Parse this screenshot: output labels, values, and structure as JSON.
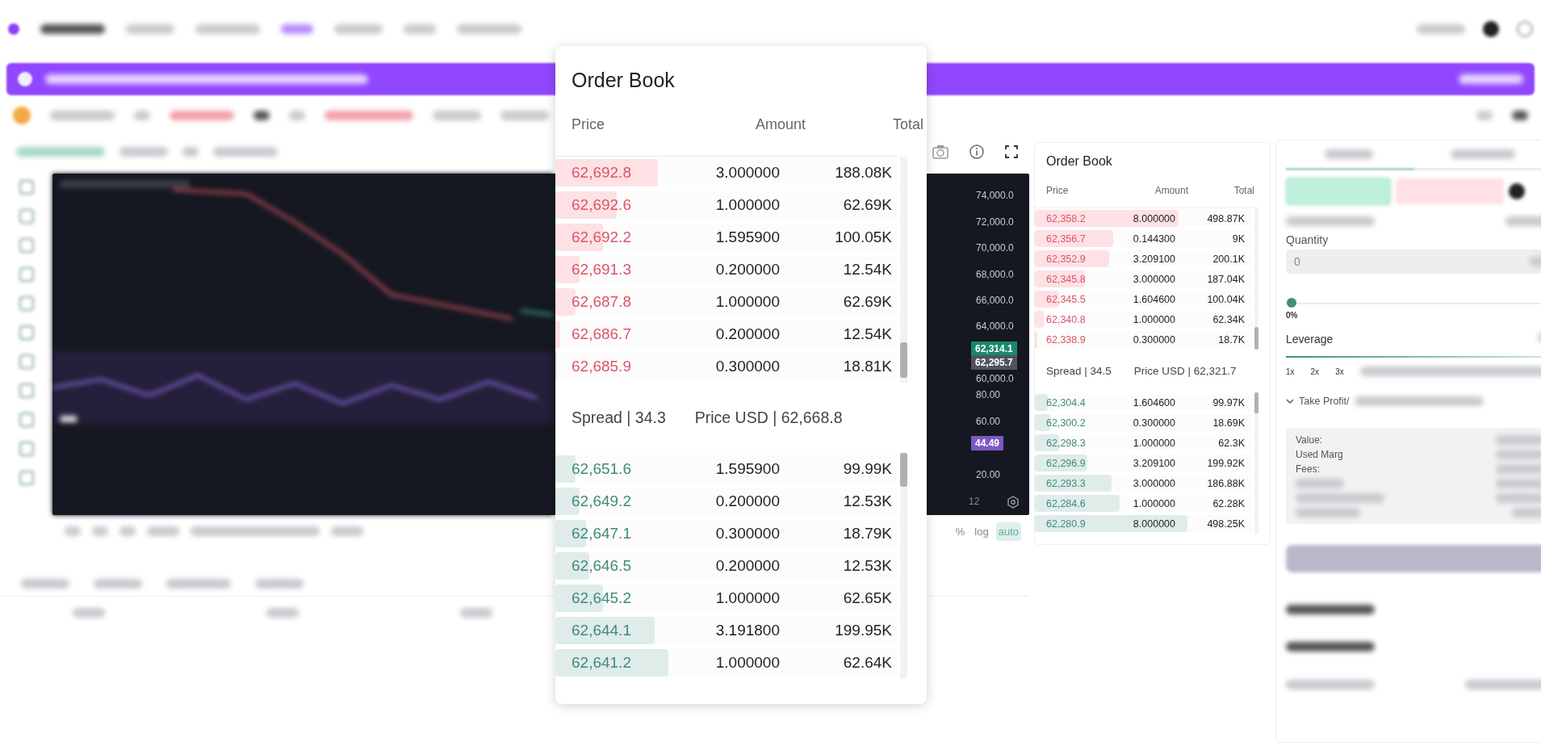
{
  "overlay_order_book": {
    "title": "Order Book",
    "columns": [
      "Price",
      "Amount",
      "Total"
    ],
    "asks": [
      {
        "price": "62,692.8",
        "amount": "3.000000",
        "total": "188.08K",
        "level": 0.3
      },
      {
        "price": "62,692.6",
        "amount": "1.000000",
        "total": "62.69K",
        "level": 0.18
      },
      {
        "price": "62,692.2",
        "amount": "1.595900",
        "total": "100.05K",
        "level": 0.14
      },
      {
        "price": "62,691.3",
        "amount": "0.200000",
        "total": "12.54K",
        "level": 0.07
      },
      {
        "price": "62,687.8",
        "amount": "1.000000",
        "total": "62.69K",
        "level": 0.06
      },
      {
        "price": "62,686.7",
        "amount": "0.200000",
        "total": "12.54K",
        "level": 0.015
      },
      {
        "price": "62,685.9",
        "amount": "0.300000",
        "total": "18.81K",
        "level": 0.005
      }
    ],
    "spread": "Spread | 34.3",
    "mid_price": "Price USD | 62,668.8",
    "bids": [
      {
        "price": "62,651.6",
        "amount": "1.595900",
        "total": "99.99K",
        "level": 0.06
      },
      {
        "price": "62,649.2",
        "amount": "0.200000",
        "total": "12.53K",
        "level": 0.07
      },
      {
        "price": "62,647.1",
        "amount": "0.300000",
        "total": "18.79K",
        "level": 0.09
      },
      {
        "price": "62,646.5",
        "amount": "0.200000",
        "total": "12.53K",
        "level": 0.1
      },
      {
        "price": "62,645.2",
        "amount": "1.000000",
        "total": "62.65K",
        "level": 0.14
      },
      {
        "price": "62,644.1",
        "amount": "3.191800",
        "total": "199.95K",
        "level": 0.29
      },
      {
        "price": "62,641.2",
        "amount": "1.000000",
        "total": "62.64K",
        "level": 0.33
      }
    ]
  },
  "chart": {
    "axis_labels": [
      {
        "text": "74,000.0",
        "kind": "price"
      },
      {
        "text": "72,000.0",
        "kind": "price"
      },
      {
        "text": "70,000.0",
        "kind": "price"
      },
      {
        "text": "68,000.0",
        "kind": "price"
      },
      {
        "text": "66,000.0",
        "kind": "price"
      },
      {
        "text": "64,000.0",
        "kind": "price"
      },
      {
        "text": "62,314.1",
        "kind": "last"
      },
      {
        "text": "62,295.7",
        "kind": "mark"
      },
      {
        "text": "60,000.0",
        "kind": "price"
      },
      {
        "text": "80.00",
        "kind": "price"
      },
      {
        "text": "60.00",
        "kind": "price"
      },
      {
        "text": "44.49",
        "kind": "indicator"
      },
      {
        "text": "20.00",
        "kind": "price"
      }
    ],
    "time_label": "12",
    "scale_options": [
      {
        "label": "%",
        "selected": false
      },
      {
        "label": "log",
        "selected": false
      },
      {
        "label": "auto",
        "selected": true
      }
    ]
  },
  "order_book": {
    "title": "Order Book",
    "columns": [
      "Price",
      "Amount",
      "Total"
    ],
    "asks": [
      {
        "price": "62,358.2",
        "amount": "8.000000",
        "total": "498.87K",
        "level": 0.66
      },
      {
        "price": "62,356.7",
        "amount": "0.144300",
        "total": "9K",
        "level": 0.36
      },
      {
        "price": "62,352.9",
        "amount": "3.209100",
        "total": "200.1K",
        "level": 0.34
      },
      {
        "price": "62,345.8",
        "amount": "3.000000",
        "total": "187.04K",
        "level": 0.23
      },
      {
        "price": "62,345.5",
        "amount": "1.604600",
        "total": "100.04K",
        "level": 0.11
      },
      {
        "price": "62,340.8",
        "amount": "1.000000",
        "total": "62.34K",
        "level": 0.04
      },
      {
        "price": "62,338.9",
        "amount": "0.300000",
        "total": "18.7K",
        "level": 0.01
      }
    ],
    "spread": "Spread | 34.5",
    "mid_price": "Price USD | 62,321.7",
    "bids": [
      {
        "price": "62,304.4",
        "amount": "1.604600",
        "total": "99.97K",
        "level": 0.06
      },
      {
        "price": "62,300.2",
        "amount": "0.300000",
        "total": "18.69K",
        "level": 0.07
      },
      {
        "price": "62,298.3",
        "amount": "1.000000",
        "total": "62.3K",
        "level": 0.11
      },
      {
        "price": "62,296.9",
        "amount": "3.209100",
        "total": "199.92K",
        "level": 0.24
      },
      {
        "price": "62,293.3",
        "amount": "3.000000",
        "total": "186.88K",
        "level": 0.35
      },
      {
        "price": "62,284.6",
        "amount": "1.000000",
        "total": "62.28K",
        "level": 0.39
      },
      {
        "price": "62,280.9",
        "amount": "8.000000",
        "total": "498.25K",
        "level": 0.7
      }
    ]
  },
  "trade_panel": {
    "quantity_label": "Quantity",
    "quantity_value": "0",
    "quantity_slider": {
      "level": 0
    },
    "percent_label": "0%",
    "leverage_label": "Leverage",
    "leverage_slider": {
      "level": 1
    },
    "leverage_ticks": [
      "1x",
      "2x",
      "3x"
    ],
    "take_profit_label": "Take Profit/",
    "summary": [
      "Value:",
      "Used Marg",
      "Fees:"
    ]
  }
}
